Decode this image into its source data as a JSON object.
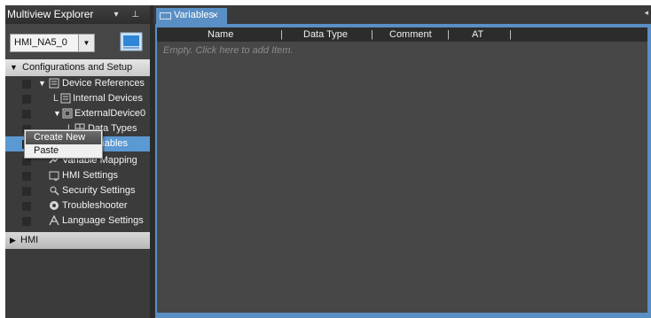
{
  "explorer": {
    "title": "Multiview Explorer",
    "header_icons": "▾ ⊥",
    "device_select_value": "HMI_NA5_0",
    "groups": {
      "config": "Configurations and Setup",
      "hmi": "HMI"
    },
    "items": [
      {
        "label": "Device References"
      },
      {
        "label": "Internal Devices"
      },
      {
        "label": "ExternalDevice0"
      },
      {
        "label": "Data Types"
      },
      {
        "label": "Variables"
      },
      {
        "label": "Variable Mapping"
      },
      {
        "label": "HMI Settings"
      },
      {
        "label": "Security Settings"
      },
      {
        "label": "Troubleshooter"
      },
      {
        "label": "Language Settings"
      }
    ],
    "tree_glyphs": {
      "expanded": "▼",
      "collapsed": "▶",
      "branch": "L"
    }
  },
  "editor": {
    "tab_label": "Variables",
    "tab_close": "×",
    "columns": {
      "name": "Name",
      "data_type": "Data Type",
      "comment": "Comment",
      "at": "AT",
      "separator": "|"
    },
    "empty_hint": "Empty. Click here to add Item."
  },
  "context_menu": {
    "create_new": "Create New",
    "paste": "Paste"
  },
  "colors": {
    "selection": "#5b99d3",
    "tab_accent": "#5a8fc5",
    "panel_bg": "#3b3b3b",
    "editor_bg": "#474747"
  }
}
